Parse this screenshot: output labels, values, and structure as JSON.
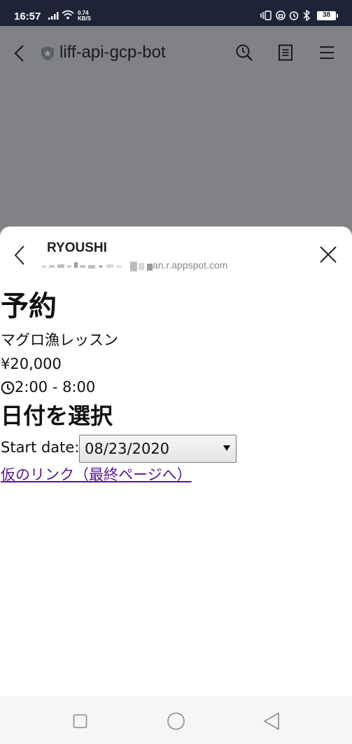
{
  "status_bar": {
    "time": "16:57",
    "speed_value": "0.74",
    "speed_unit": "KB/S",
    "battery": "38",
    "background_color": "#1d2438"
  },
  "browser": {
    "title": "liff-api-gcp-bot",
    "icons": [
      "back-chevron-icon",
      "shield-star-icon",
      "search-icon",
      "document-icon",
      "menu-icon"
    ]
  },
  "sheet": {
    "title": "RYOUSHI",
    "url_suffix": "an.r.appspot.com",
    "icons": [
      "back-chevron-icon",
      "close-icon"
    ]
  },
  "page": {
    "heading": "予約",
    "lesson_name": "マグロ漁レッスン",
    "price": "¥20,000",
    "time": "2:00 - 8:00",
    "section_heading": "日付を選択",
    "date_label": "Start date:",
    "date_value": "08/23/2020",
    "link_text": "仮のリンク（最終ページへ）",
    "link_color": "#551a8b"
  },
  "nav_bar": {
    "icons": [
      "recent-apps-icon",
      "home-icon",
      "back-icon"
    ]
  }
}
